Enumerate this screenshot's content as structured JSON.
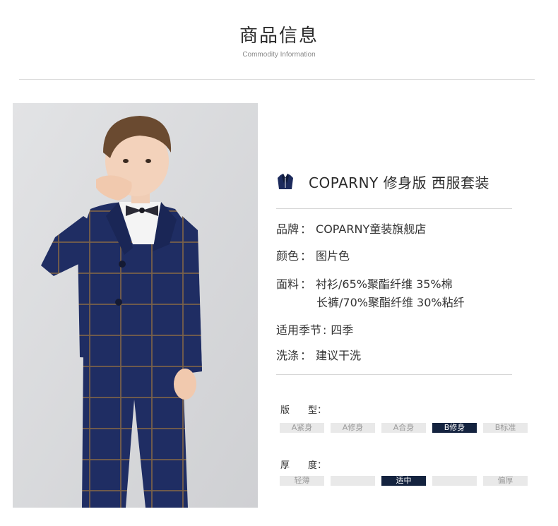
{
  "header": {
    "title": "商品信息",
    "subtitle": "Commodity Information"
  },
  "product": {
    "icon": "suit-icon",
    "title": "COPARNY 修身版 西服套装"
  },
  "specs": [
    {
      "label": "品牌",
      "value": "COPARNY童装旗舰店"
    },
    {
      "label": "颜色",
      "value": "图片色"
    },
    {
      "label": "面料",
      "value": "衬衫/65%聚酯纤维 35%棉",
      "value2": "长裤/70%聚酯纤维 30%粘纤"
    },
    {
      "label": "适用季节",
      "value": "四季"
    },
    {
      "label": "洗涤",
      "value": "建议干洗"
    }
  ],
  "fit": {
    "label_a": "版",
    "label_b": "型：",
    "options": [
      "A紧身",
      "A修身",
      "A合身",
      "B修身",
      "B标准"
    ],
    "selected": "B修身"
  },
  "thickness": {
    "label_a": "厚",
    "label_b": "度：",
    "options": [
      "轻薄",
      "",
      "适中",
      "",
      "偏厚"
    ],
    "selected": "适中"
  },
  "colors": {
    "accent": "#14233f",
    "suit": "#1c2a5c",
    "check": "#8a6a4a"
  }
}
